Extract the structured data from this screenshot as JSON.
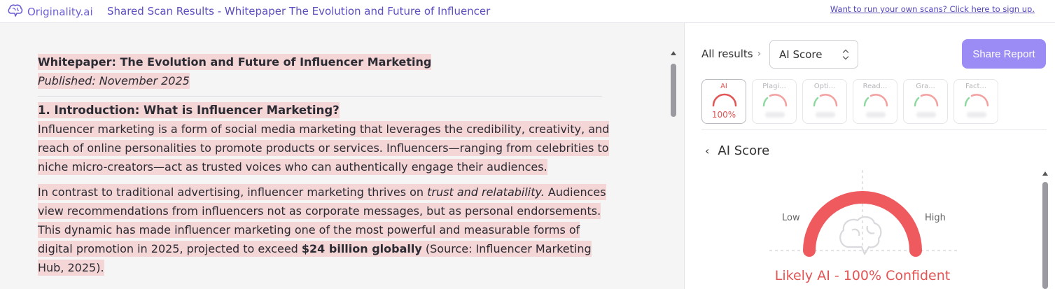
{
  "header": {
    "brand": "Originality.ai",
    "title": "Shared Scan Results - Whitepaper The Evolution and Future of Influencer",
    "signup_link": "Want to run your own scans? Click here to sign up."
  },
  "document": {
    "title": "Whitepaper: The Evolution and Future of Influencer Marketing",
    "published": "Published: November 2025",
    "section_heading": "1. Introduction: What is Influencer Marketing?",
    "para1": [
      "Influencer marketing is a form of social media marketing that leverages the credibility, creativity, and",
      "reach of online personalities to promote products or services. Influencers—ranging from celebrities to",
      "niche micro-creators—act as trusted voices who can authentically engage their audiences."
    ],
    "para2": {
      "l1_a": "In contrast to traditional advertising, influencer marketing thrives on ",
      "l1_em": "trust and relatability.",
      "l1_b": " Audiences",
      "l2": "view recommendations from influencers not as corporate messages, but as personal endorsements.",
      "l3": "This dynamic has made influencer marketing one of the most powerful and measurable forms of",
      "l4_a": "digital promotion in 2025, projected to exceed ",
      "l4_strong": "$24 billion globally",
      "l4_b": " (Source: Influencer Marketing",
      "l5": "Hub, 2025)."
    },
    "highlight_color": "#f5d6d7"
  },
  "panel": {
    "breadcrumb": "All results",
    "select_value": "AI Score",
    "share_button": "Share Report",
    "tabs": [
      {
        "label": "AI",
        "value": "100%",
        "active": true,
        "color": "#e25555"
      },
      {
        "label": "Plagi...",
        "active": false,
        "color": "#f3a0a0"
      },
      {
        "label": "Opti...",
        "active": false,
        "color": "#f3a0a0"
      },
      {
        "label": "Read...",
        "active": false,
        "color": "#f3a0a0"
      },
      {
        "label": "Gra...",
        "active": false,
        "color": "#f3a0a0"
      },
      {
        "label": "Fact...",
        "active": false,
        "color": "#f3a0a0"
      }
    ],
    "section_title": "AI Score",
    "gauge": {
      "low_label": "Low",
      "high_label": "High",
      "score_fraction": 1.0,
      "color": "#ef5a5e",
      "verdict": "Likely AI - 100% Confident"
    },
    "icons": [
      "brain-logo-icon",
      "chevron-right-icon",
      "updown-arrows-icon",
      "chevron-left-icon",
      "brain-watermark-icon"
    ]
  }
}
